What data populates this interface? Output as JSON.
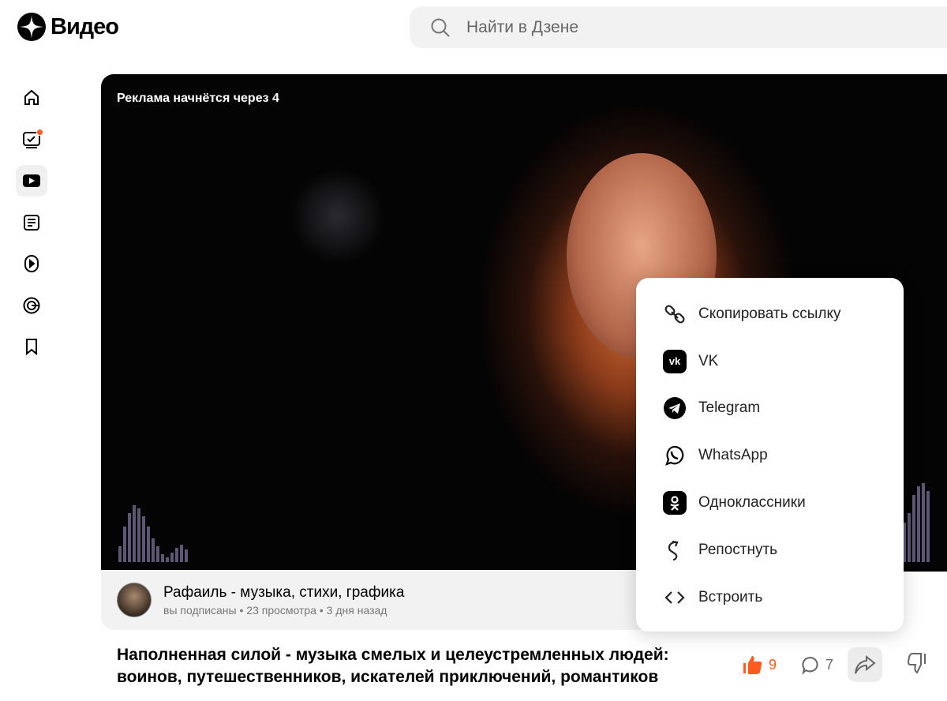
{
  "header": {
    "logo_text": "Видео",
    "search_placeholder": "Найти в Дзене"
  },
  "sidebar": {
    "items": [
      {
        "icon": "home-icon"
      },
      {
        "icon": "subscriptions-icon",
        "badge": true
      },
      {
        "icon": "video-icon",
        "active": true
      },
      {
        "icon": "articles-icon"
      },
      {
        "icon": "shorts-icon"
      },
      {
        "icon": "channels-icon"
      },
      {
        "icon": "bookmark-icon"
      }
    ]
  },
  "video": {
    "ad_notice": "Реклама начнётся через 4"
  },
  "channel": {
    "name": "Рафаиль - музыка, стихи, графика",
    "meta": "вы подписаны • 23 просмотра • 3 дня назад"
  },
  "post": {
    "title": "Наполненная силой - музыка смелых и целеустремленных людей: воинов, путешественников, искателей приключений, романтиков"
  },
  "actions": {
    "likes": "9",
    "comments": "7",
    "accent": "#ff5a1f"
  },
  "share_menu": {
    "items": [
      {
        "label": "Скопировать ссылку",
        "icon": "link-icon"
      },
      {
        "label": "VK",
        "icon": "vk-icon"
      },
      {
        "label": "Telegram",
        "icon": "telegram-icon"
      },
      {
        "label": "WhatsApp",
        "icon": "whatsapp-icon"
      },
      {
        "label": "Одноклассники",
        "icon": "ok-icon"
      },
      {
        "label": "Репостнуть",
        "icon": "repost-icon"
      },
      {
        "label": "Встроить",
        "icon": "embed-icon"
      }
    ]
  }
}
